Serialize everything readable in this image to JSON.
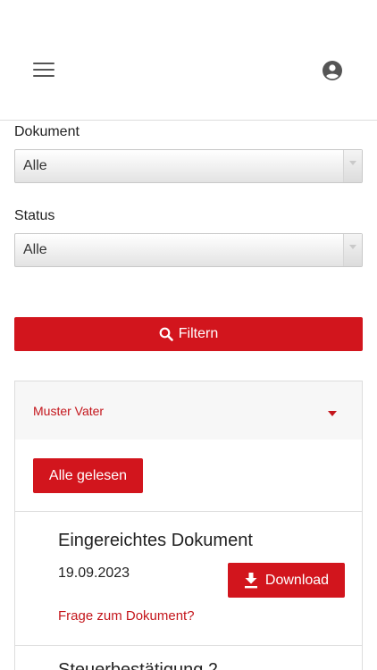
{
  "filters": {
    "document_label": "Dokument",
    "document_value": "Alle",
    "status_label": "Status",
    "status_value": "Alle",
    "filter_button": "Filtern"
  },
  "card": {
    "person_name": "Muster Vater",
    "read_all_button": "Alle gelesen",
    "documents": [
      {
        "title": "Eingereichtes Dokument",
        "date": "19.09.2023",
        "download_button": "Download",
        "question_link": "Frage zum Dokument?"
      },
      {
        "title": "Steuerbestätigung 2"
      }
    ]
  },
  "colors": {
    "accent": "#d2151d",
    "link": "#c4161c"
  },
  "icons": [
    "menu-icon",
    "account-circle-icon",
    "dropdown-arrow-icon",
    "search-icon",
    "caret-down-icon",
    "download-icon"
  ]
}
